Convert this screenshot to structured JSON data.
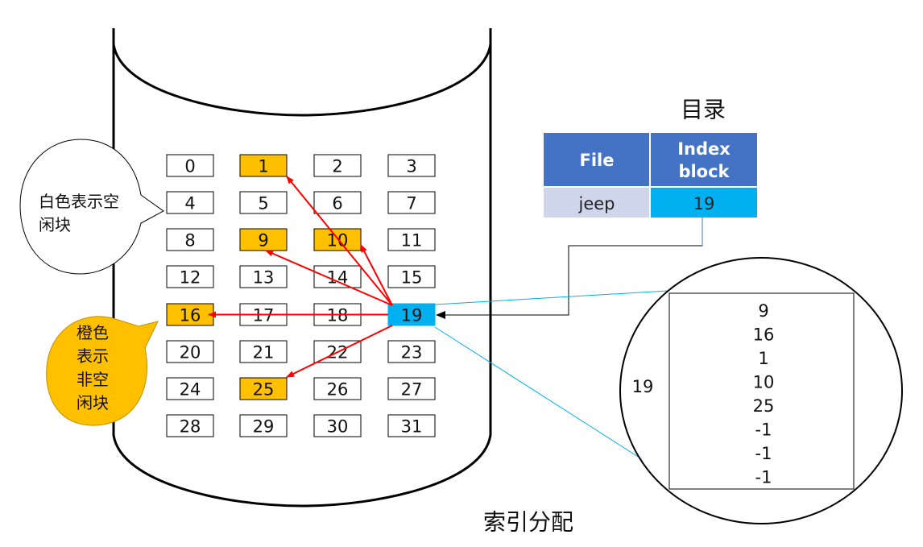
{
  "title": "索引分配",
  "disk": {
    "blocks": [
      {
        "n": "0",
        "state": "free"
      },
      {
        "n": "1",
        "state": "used"
      },
      {
        "n": "2",
        "state": "free"
      },
      {
        "n": "3",
        "state": "free"
      },
      {
        "n": "4",
        "state": "free"
      },
      {
        "n": "5",
        "state": "free"
      },
      {
        "n": "6",
        "state": "free"
      },
      {
        "n": "7",
        "state": "free"
      },
      {
        "n": "8",
        "state": "free"
      },
      {
        "n": "9",
        "state": "used"
      },
      {
        "n": "10",
        "state": "used"
      },
      {
        "n": "11",
        "state": "free"
      },
      {
        "n": "12",
        "state": "free"
      },
      {
        "n": "13",
        "state": "free"
      },
      {
        "n": "14",
        "state": "free"
      },
      {
        "n": "15",
        "state": "free"
      },
      {
        "n": "16",
        "state": "used"
      },
      {
        "n": "17",
        "state": "free"
      },
      {
        "n": "18",
        "state": "free"
      },
      {
        "n": "19",
        "state": "index"
      },
      {
        "n": "20",
        "state": "free"
      },
      {
        "n": "21",
        "state": "free"
      },
      {
        "n": "22",
        "state": "free"
      },
      {
        "n": "23",
        "state": "free"
      },
      {
        "n": "24",
        "state": "free"
      },
      {
        "n": "25",
        "state": "used"
      },
      {
        "n": "26",
        "state": "free"
      },
      {
        "n": "27",
        "state": "free"
      },
      {
        "n": "28",
        "state": "free"
      },
      {
        "n": "29",
        "state": "free"
      },
      {
        "n": "30",
        "state": "free"
      },
      {
        "n": "31",
        "state": "free"
      }
    ],
    "index_block": 19,
    "pointers_to": [
      1,
      9,
      10,
      16,
      25
    ]
  },
  "colors": {
    "free": "#ffffff",
    "used": "#ffc000",
    "index": "#00b0f0",
    "arrow": "#ff0000",
    "header": "#4472c4",
    "file_cell": "#cfd5ea",
    "zoom_line": "#00b0f0"
  },
  "callouts": {
    "free_lines": [
      "白色表示空",
      "闲块"
    ],
    "used_lines": [
      "橙色",
      "表示",
      "非空",
      "闲块"
    ]
  },
  "directory": {
    "title": "目录",
    "headers": [
      "File",
      "Index block"
    ],
    "header_lines": [
      [
        "File"
      ],
      [
        "Index",
        "block"
      ]
    ],
    "rows": [
      {
        "file": "jeep",
        "index_block": "19"
      }
    ]
  },
  "index_block_detail": {
    "label": "19",
    "entries": [
      "9",
      "16",
      "1",
      "10",
      "25",
      "-1",
      "-1",
      "-1"
    ]
  }
}
